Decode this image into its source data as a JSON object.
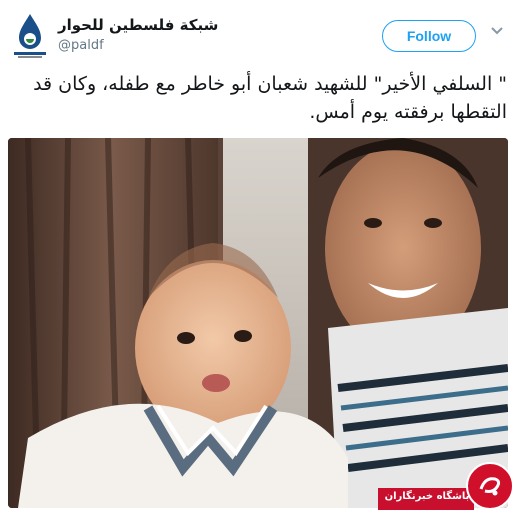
{
  "account": {
    "display_name": "شبكة فلسطين للحوار",
    "handle": "@paldf",
    "avatar_icon": "paldf-logo-icon"
  },
  "actions": {
    "follow_label": "Follow",
    "menu_icon": "chevron-down-icon"
  },
  "tweet": {
    "text": "\" السلفي الأخير\" للشهيد شعبان أبو خاطر مع طفله، وكان قد التقطها برفقته يوم أمس."
  },
  "watermark": {
    "label": "باشگاه خبرنگاران"
  },
  "colors": {
    "accent": "#1da1f2",
    "watermark_red": "#c8102e"
  }
}
